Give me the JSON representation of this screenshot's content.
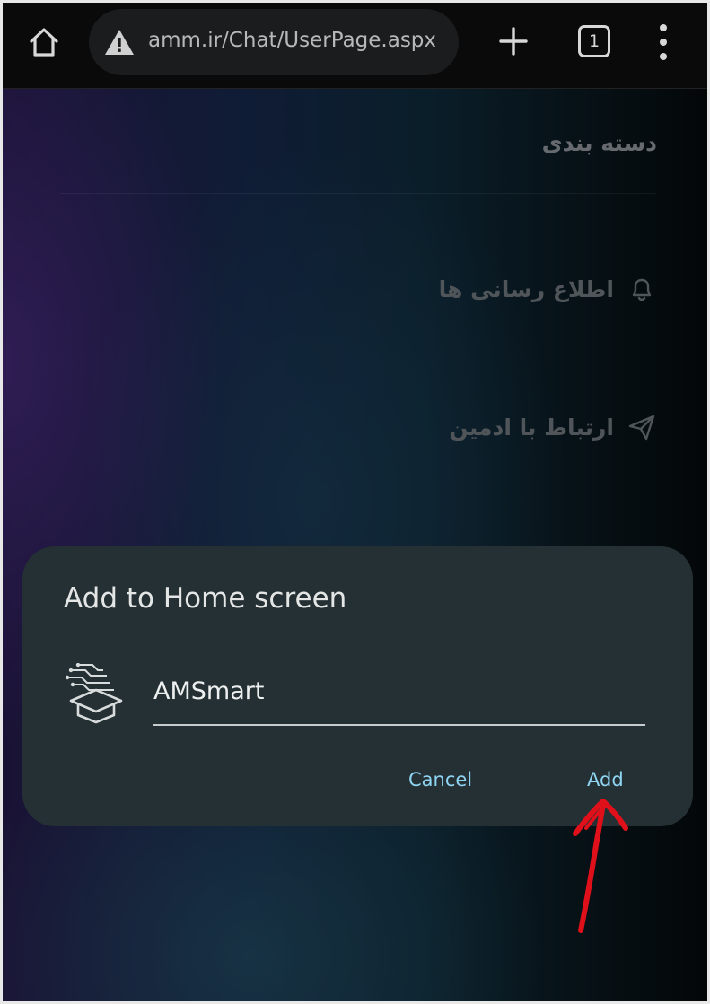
{
  "browser": {
    "url": "amm.ir/Chat/UserPage.aspx",
    "tab_count": "1",
    "icons": {
      "home": "home-icon",
      "warning": "warning-triangle-icon",
      "new_tab": "plus-icon",
      "menu": "more-vert-icon"
    }
  },
  "page": {
    "title": "دسته بندی",
    "nav": [
      {
        "label": "اطلاع رسانی ها",
        "icon": "bell-icon"
      },
      {
        "label": "ارتباط با ادمین",
        "icon": "send-icon"
      }
    ]
  },
  "dialog": {
    "title": "Add to Home screen",
    "app_name": "AMSmart",
    "cancel_label": "Cancel",
    "add_label": "Add",
    "accent_color": "#8fd4f2"
  },
  "annotation": {
    "arrow_color": "#e0101a",
    "points_to": "add-button"
  }
}
